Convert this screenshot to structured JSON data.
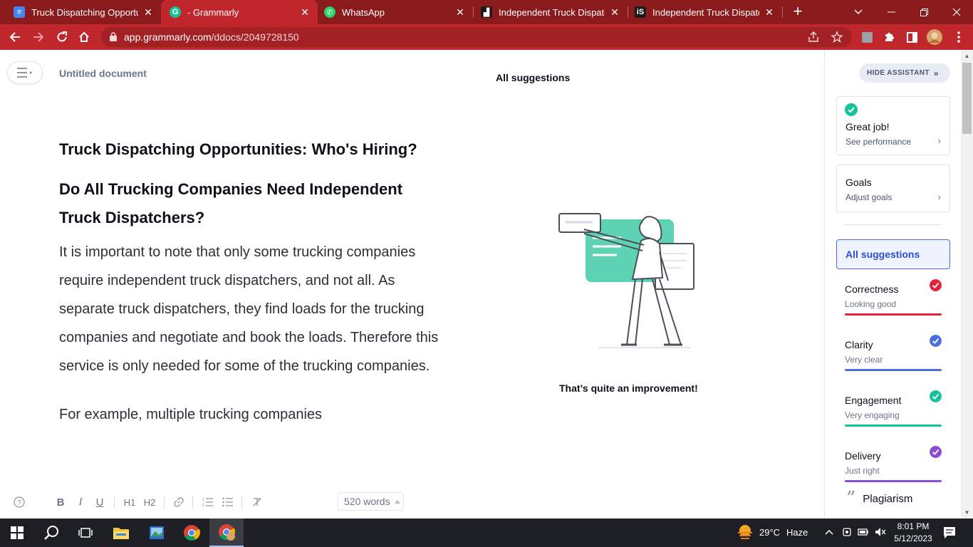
{
  "browser": {
    "tabs": [
      {
        "title": "Truck Dispatching Opportunit",
        "favicon": "docs-icon",
        "active": false
      },
      {
        "title": "- Grammarly",
        "favicon": "grammarly-icon",
        "active": true
      },
      {
        "title": "WhatsApp",
        "favicon": "whatsapp-icon",
        "active": false
      },
      {
        "title": "Independent Truck Dispatche",
        "favicon": "site-icon",
        "active": false
      },
      {
        "title": "Independent Truck Dispatche",
        "favicon": "is-icon",
        "active": false
      }
    ],
    "tab_close": "✕",
    "new_tab": "+",
    "url_domain": "app.grammarly.com",
    "url_path": "/ddocs/2049728150"
  },
  "editor": {
    "doc_title": "Untitled document",
    "heading1": "Truck Dispatching Opportunities: Who's Hiring?",
    "heading2": "Do All Trucking Companies Need Independent Truck Dispatchers?",
    "paragraph1": "It is important to note that only some trucking companies require independent truck dispatchers, and not all. As separate truck dispatchers, they find loads for the trucking companies and negotiate and book the loads. Therefore this service is only needed for some of the trucking companies.",
    "paragraph2": "For example, multiple trucking companies",
    "word_count": "520 words",
    "format_buttons": [
      "B",
      "I",
      "U",
      "H1",
      "H2"
    ]
  },
  "center_panel": {
    "heading": "All suggestions",
    "message": "That’s quite an improvement!"
  },
  "assistant": {
    "hide_label": "HIDE ASSISTANT",
    "performance": {
      "title": "Great job!",
      "subtitle": "See performance"
    },
    "goals": {
      "title": "Goals",
      "subtitle": "Adjust goals"
    },
    "all_suggestions": "All suggestions",
    "metrics": [
      {
        "title": "Correctness",
        "status": "Looking good",
        "color": "#e5223b"
      },
      {
        "title": "Clarity",
        "status": "Very clear",
        "color": "#4a6ee0"
      },
      {
        "title": "Engagement",
        "status": "Very engaging",
        "color": "#15c39a"
      },
      {
        "title": "Delivery",
        "status": "Just right",
        "color": "#8e4bd2"
      }
    ],
    "plagiarism": "Plagiarism"
  },
  "taskbar": {
    "weather_temp": "29°C",
    "weather_desc": "Haze",
    "time": "8:01 PM",
    "date": "5/12/2023"
  },
  "colors": {
    "tab_strip": "#8b1a1c",
    "toolbar": "#c0272d",
    "grammarly_green": "#15c39a"
  }
}
